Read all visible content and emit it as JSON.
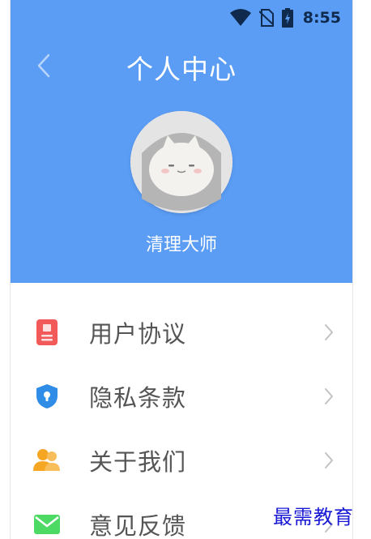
{
  "status_bar": {
    "time": "8:55",
    "icons": [
      "wifi-icon",
      "no-sim-icon",
      "battery-charging-icon"
    ]
  },
  "header": {
    "title": "个人中心",
    "back_icon": "chevron-left-icon",
    "background_color": "#5b9df5"
  },
  "profile": {
    "avatar_icon": "avatar-icon",
    "username": "清理大师"
  },
  "menu": {
    "items": [
      {
        "label": "用户协议",
        "icon": "document-icon",
        "icon_color": "#f25a5a"
      },
      {
        "label": "隐私条款",
        "icon": "shield-lock-icon",
        "icon_color": "#2f8de8"
      },
      {
        "label": "关于我们",
        "icon": "users-icon",
        "icon_color": "#f5a623"
      },
      {
        "label": "意见反馈",
        "icon": "mail-icon",
        "icon_color": "#4cd964"
      }
    ]
  },
  "watermark": "最需教育"
}
